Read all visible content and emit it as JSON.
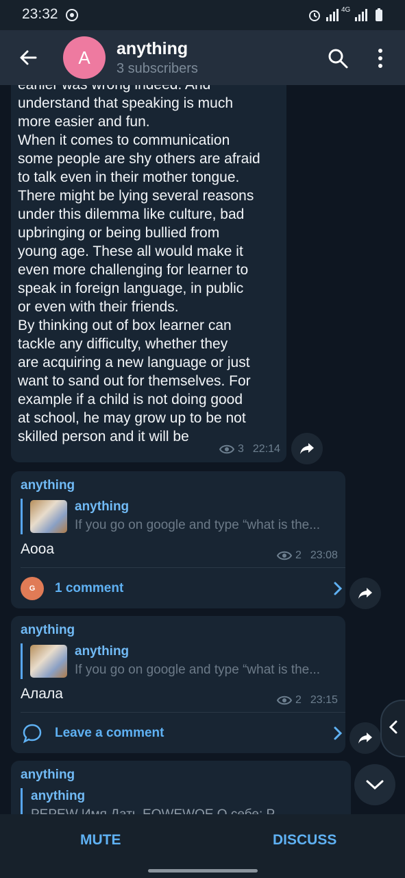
{
  "status": {
    "time": "23:32",
    "net": "4G"
  },
  "header": {
    "avatar_letter": "A",
    "title": "anything",
    "subtitle": "3 subscribers"
  },
  "post1": {
    "text": "earlier was wrong indeed. And\nunderstand that speaking is much\nmore easier and fun.\nWhen it comes to communication\nsome people are shy others are afraid\nto talk even in their mother tongue.\nThere might be lying several reasons\nunder this dilemma like culture, bad\nupbringing or being bullied from\nyoung age. These all would make it\neven more challenging for learner to\nspeak in foreign language, in public\nor even with their friends.\nBy thinking out of box learner can\ntackle any difficulty, whether they\nare acquiring a new language or just\nwant to sand out for themselves. For\nexample if a child is not doing good\nat school, he may grow up to be not\nskilled person and it will be",
    "views": "3",
    "time": "22:14"
  },
  "post2": {
    "sender": "anything",
    "reply_name": "anything",
    "reply_text": "If you go on google and type “what is the...",
    "text": "Аооа",
    "views": "2",
    "time": "23:08",
    "comment_avatar": "G",
    "comment_label": "1 comment"
  },
  "post3": {
    "sender": "anything",
    "reply_name": "anything",
    "reply_text": "If you go on google and type “what is the...",
    "text": "Алала",
    "views": "2",
    "time": "23:15",
    "comment_label": "Leave a comment"
  },
  "post4": {
    "sender": "anything",
    "reply_name": "anything",
    "reply_text": "PEPEW  Имя  Дать  EOWEWOE  О себе:  PEWPEW"
  },
  "bottom": {
    "mute": "MUTE",
    "discuss": "DISCUSS"
  },
  "colors": {
    "accent": "#5fb1f3",
    "bubble": "#182533",
    "background": "#0e1621"
  }
}
